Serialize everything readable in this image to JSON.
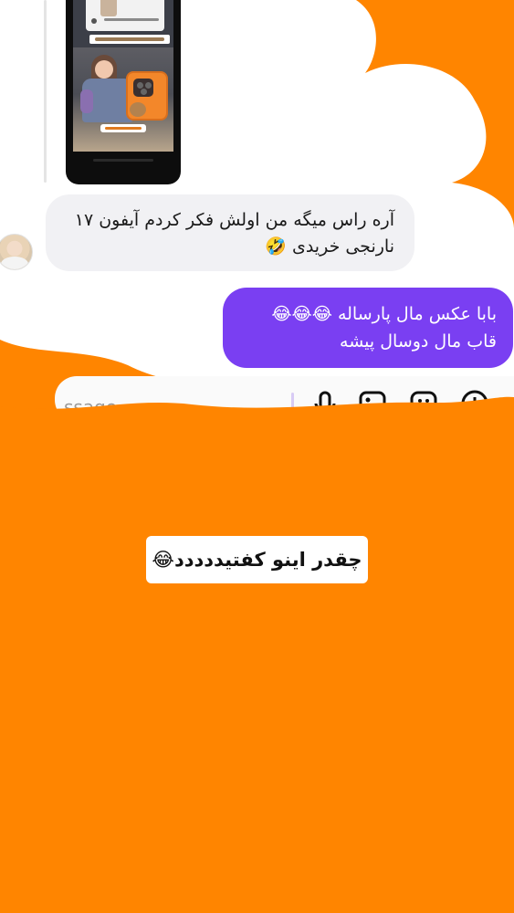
{
  "colors": {
    "background_orange": "#ff8500",
    "outgoing_bubble": "#7a3ff2",
    "incoming_bubble": "#f1f1f4",
    "cloud": "#ffffff"
  },
  "shared_media": {
    "icon": "phone-screenshot-image"
  },
  "messages": {
    "incoming": {
      "line1": "آره راس میگه من اولش فکر کردم آیفون ۱۷",
      "line2": "نارنجی خریدی 🤣"
    },
    "outgoing": {
      "line1": "بابا عکس مال پارساله 😂😂😂",
      "line2": "قاب مال دوسال پیشه"
    }
  },
  "composer": {
    "placeholder": "ssage...",
    "icons": [
      "microphone-icon",
      "gallery-icon",
      "sticker-icon",
      "add-icon"
    ]
  },
  "caption": {
    "text": "چقدر اینو کفتیددددد😂"
  }
}
